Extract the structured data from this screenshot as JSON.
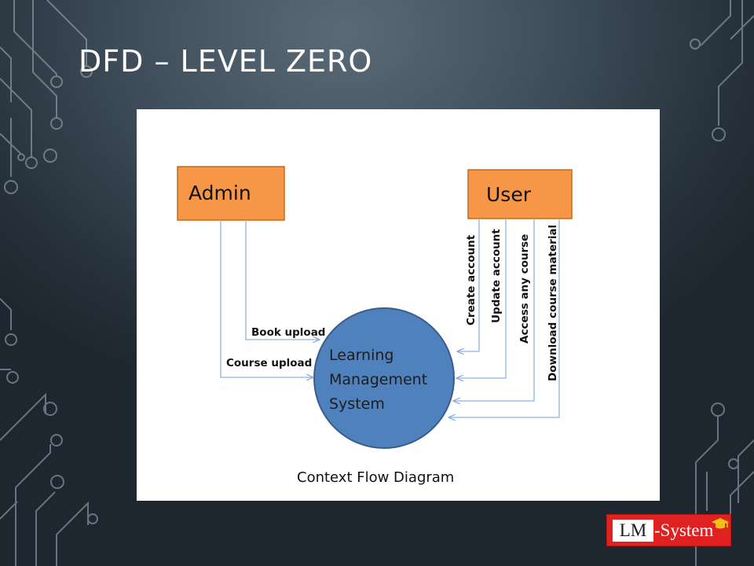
{
  "slide": {
    "title": "DFD – LEVEL ZERO"
  },
  "diagram": {
    "entities": {
      "admin": "Admin",
      "user": "User"
    },
    "process": {
      "line1": "Learning",
      "line2": "Management",
      "line3": "System"
    },
    "flows": {
      "book_upload": "Book upload",
      "course_upload": "Course upload",
      "create_account": "Create account",
      "update_account": "Update account",
      "access_any_course": "Access any course",
      "download_course_material": "Download course material"
    },
    "caption": "Context Flow Diagram"
  },
  "logo": {
    "lm": "LM",
    "rest": "-System"
  },
  "colors": {
    "entity_fill": "#f79646",
    "process_fill": "#4f81bd",
    "arrow": "#8eb4e3",
    "logo_red": "#e02121"
  }
}
